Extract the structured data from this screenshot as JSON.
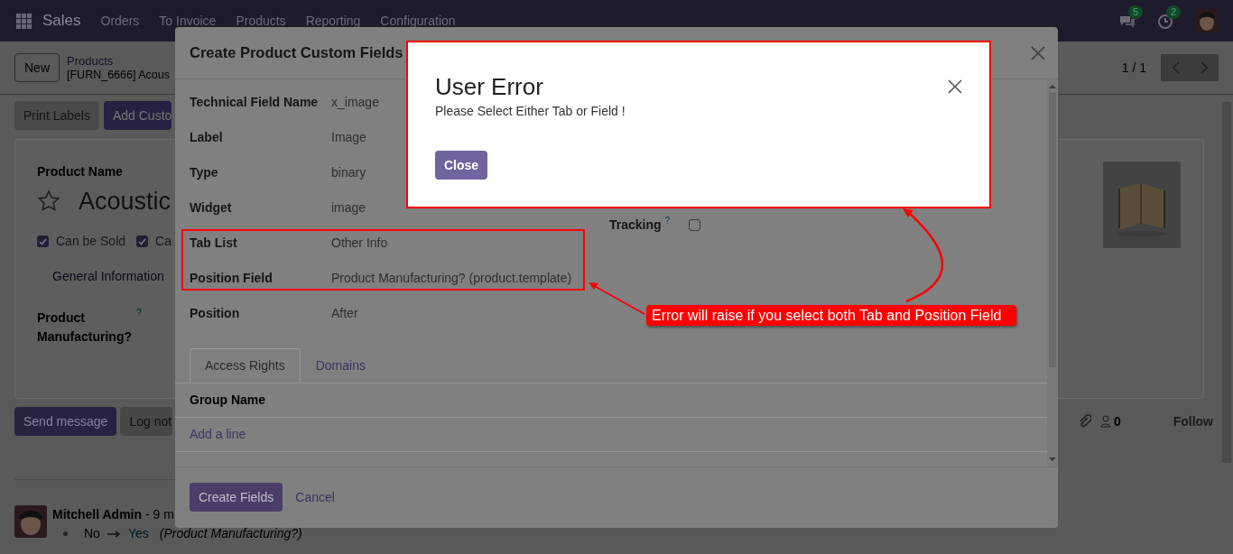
{
  "navbar": {
    "app": "Sales",
    "menu": [
      "Orders",
      "To Invoice",
      "Products",
      "Reporting",
      "Configuration"
    ],
    "messages_badge": "5",
    "activities_badge": "2"
  },
  "control_panel": {
    "new_button": "New",
    "breadcrumb": "Products",
    "record": "[FURN_6666] Acous",
    "pager": "1 / 1"
  },
  "action_buttons": [
    "Print Labels",
    "Add Custo"
  ],
  "product_form": {
    "name_label": "Product Name",
    "name": "Acoustic",
    "options": [
      {
        "label": "Can be Sold",
        "checked": true
      },
      {
        "label": "Ca",
        "checked": true
      }
    ],
    "tab": "General Information",
    "field_label": "Product Manufacturing?",
    "field_help": "?"
  },
  "chatter": {
    "buttons": [
      "Send message",
      "Log not"
    ],
    "followers": "0",
    "follow": "Follow",
    "message": {
      "author": "Mitchell Admin",
      "time": "- 9 m",
      "old_value": "No",
      "new_value": "Yes",
      "field": "(Product Manufacturing?)"
    }
  },
  "dialog": {
    "title": "Create Product Custom Fields",
    "fields": [
      {
        "label": "Technical Field Name",
        "value": "x_image",
        "highlighted": false
      },
      {
        "label": "Label",
        "value": "Image",
        "highlighted": false
      },
      {
        "label": "Type",
        "value": "binary",
        "highlighted": false
      },
      {
        "label": "Widget",
        "value": "image",
        "highlighted": false
      },
      {
        "label": "Tab List",
        "value": "Other Info",
        "highlighted": true
      },
      {
        "label": "Position Field",
        "value": "Product Manufacturing? (product.template)",
        "highlighted": true
      },
      {
        "label": "Position",
        "value": "After",
        "highlighted": false
      }
    ],
    "tracking": {
      "label": "Tracking",
      "help": "?",
      "checked": false
    },
    "tabs": [
      {
        "label": "Access Rights",
        "selected": true
      },
      {
        "label": "Domains",
        "selected": false
      }
    ],
    "table": {
      "columns": [
        "Group Name"
      ],
      "add_line": "Add a line"
    },
    "buttons": [
      {
        "label": "Create Fields",
        "kind": "primary"
      },
      {
        "label": "Cancel",
        "kind": "link"
      }
    ]
  },
  "error_dialog": {
    "title": "User Error",
    "message": "Please Select Either Tab or Field !",
    "button": "Close"
  },
  "annotation": {
    "callout": "Error will raise if you select both Tab and Position Field"
  }
}
